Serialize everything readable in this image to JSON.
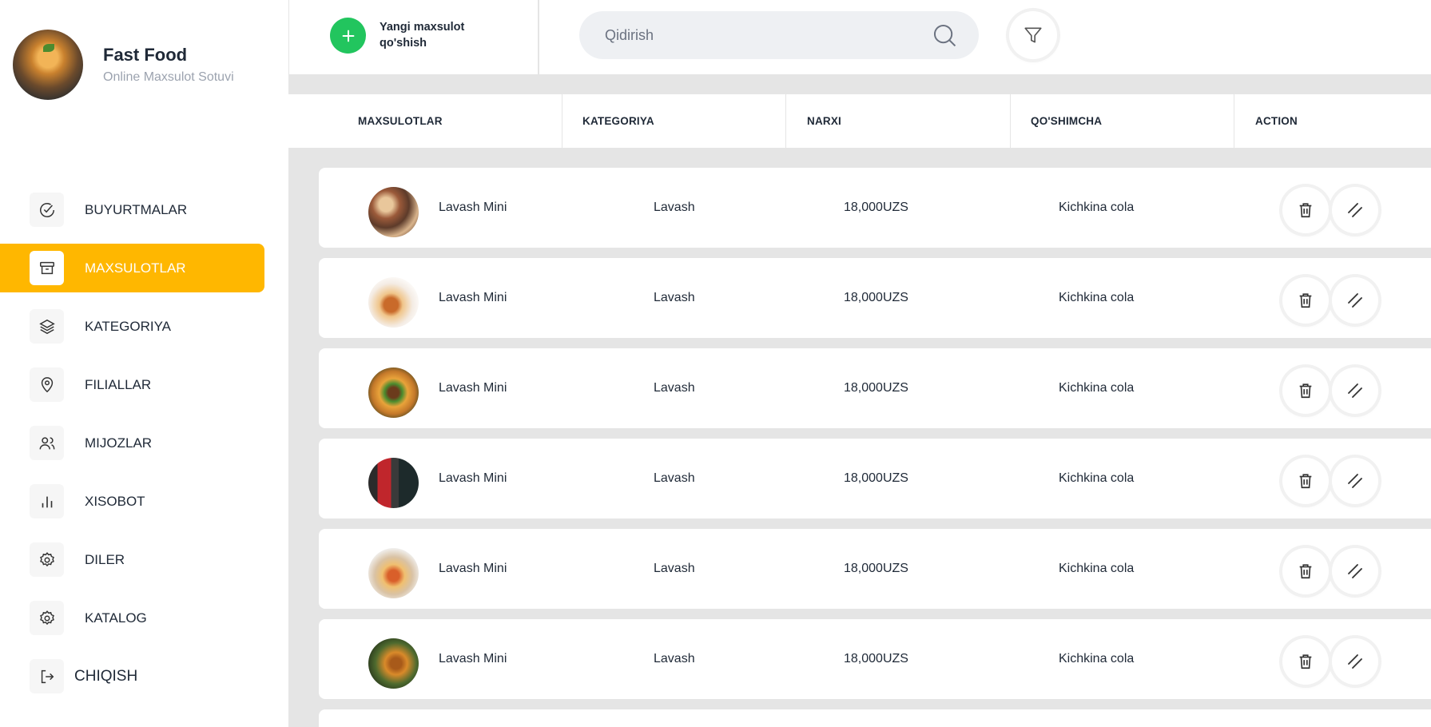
{
  "brand": {
    "title": "Fast Food",
    "subtitle": "Online Maxsulot Sotuvi"
  },
  "sidebar": {
    "items": [
      {
        "label": "BUYURTMALAR",
        "icon": "check-circle-icon",
        "active": false
      },
      {
        "label": "MAXSULOTLAR",
        "icon": "archive-box-icon",
        "active": true
      },
      {
        "label": "KATEGORIYA",
        "icon": "layers-icon",
        "active": false
      },
      {
        "label": "FILIALLAR",
        "icon": "map-pin-icon",
        "active": false
      },
      {
        "label": "MIJOZLAR",
        "icon": "users-icon",
        "active": false
      },
      {
        "label": "XISOBOT",
        "icon": "bar-chart-icon",
        "active": false
      },
      {
        "label": "DILER",
        "icon": "gear-icon",
        "active": false
      },
      {
        "label": "KATALOG",
        "icon": "gear-icon",
        "active": false
      }
    ],
    "logout": {
      "label": "CHIQISH",
      "icon": "logout-icon"
    }
  },
  "toolbar": {
    "add_label_line1": "Yangi maxsulot",
    "add_label_line2": "qo'shish",
    "search_placeholder": "Qidirish"
  },
  "table": {
    "columns": [
      "MAXSULOTLAR",
      "KATEGORIYA",
      "NARXI",
      "QO'SHIMCHA",
      "ACTION"
    ],
    "rows": [
      {
        "name": "Lavash Mini",
        "category": "Lavash",
        "price": "18,000UZS",
        "extra": "Kichkina cola"
      },
      {
        "name": "Lavash Mini",
        "category": "Lavash",
        "price": "18,000UZS",
        "extra": "Kichkina cola"
      },
      {
        "name": "Lavash Mini",
        "category": "Lavash",
        "price": "18,000UZS",
        "extra": "Kichkina cola"
      },
      {
        "name": "Lavash Mini",
        "category": "Lavash",
        "price": "18,000UZS",
        "extra": "Kichkina cola"
      },
      {
        "name": "Lavash Mini",
        "category": "Lavash",
        "price": "18,000UZS",
        "extra": "Kichkina cola"
      },
      {
        "name": "Lavash Mini",
        "category": "Lavash",
        "price": "18,000UZS",
        "extra": "Kichkina cola"
      }
    ]
  },
  "colors": {
    "accent": "#ffb700",
    "add_button": "#22c55e",
    "content_bg": "#e5e5e5"
  }
}
